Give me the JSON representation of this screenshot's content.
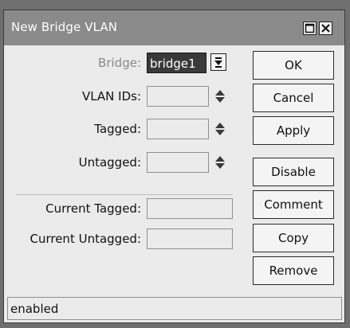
{
  "window": {
    "title": "New Bridge VLAN"
  },
  "form": {
    "bridge": {
      "label": "Bridge:",
      "value": "bridge1"
    },
    "vlan_ids": {
      "label": "VLAN IDs:",
      "value": ""
    },
    "tagged": {
      "label": "Tagged:",
      "value": ""
    },
    "untagged": {
      "label": "Untagged:",
      "value": ""
    },
    "current_tagged": {
      "label": "Current Tagged:",
      "value": ""
    },
    "current_untagged": {
      "label": "Current Untagged:",
      "value": ""
    }
  },
  "buttons": {
    "ok": "OK",
    "cancel": "Cancel",
    "apply": "Apply",
    "disable": "Disable",
    "comment": "Comment",
    "copy": "Copy",
    "remove": "Remove"
  },
  "status": {
    "text": "enabled"
  },
  "icons": {
    "maximize": "maximize-icon",
    "close": "close-icon",
    "dropdown": "dropdown-arrow-icon",
    "updown": "up-down-arrows-icon"
  },
  "colors": {
    "titlebar": "#8a8a8a",
    "window_bg": "#ebebeb",
    "selected_field": "#3a3a3a",
    "disabled_label": "#8a8a8a"
  }
}
